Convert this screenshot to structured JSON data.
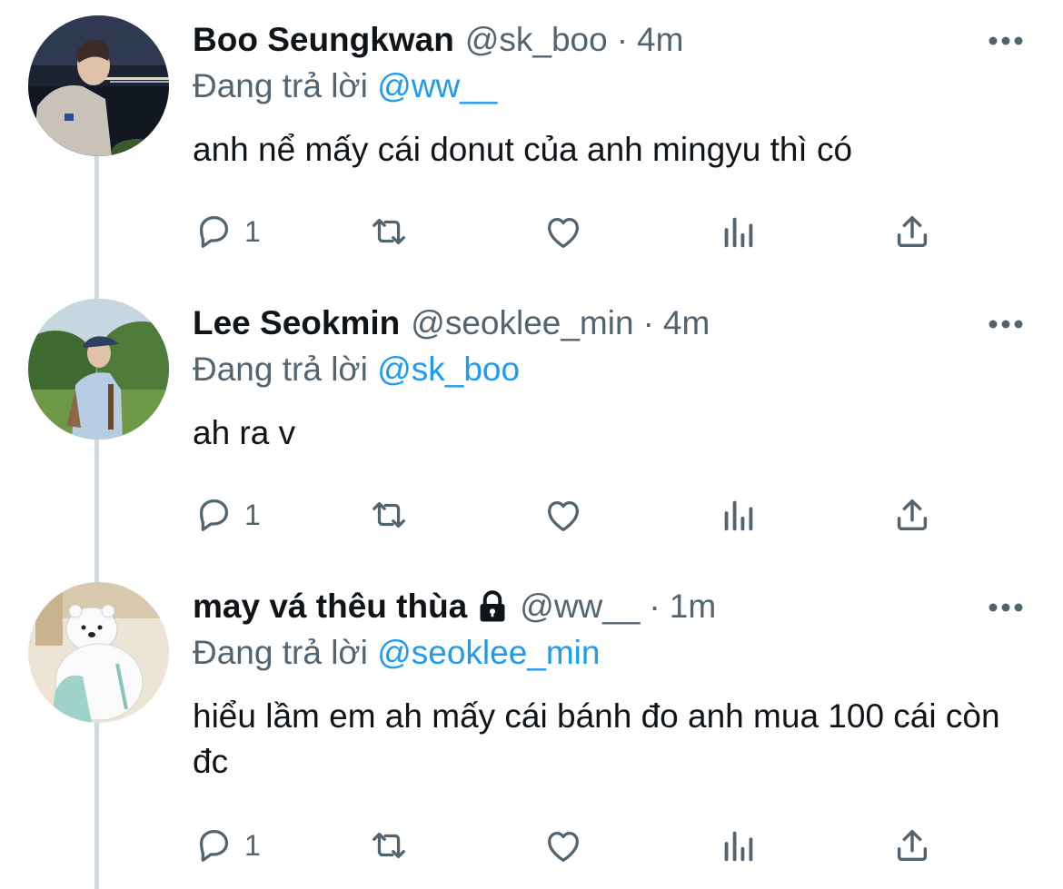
{
  "colors": {
    "text": "#0f1419",
    "secondary": "#536471",
    "link": "#1d9bf0",
    "thread_line": "#cfd9de"
  },
  "tweets": [
    {
      "name": "Boo Seungkwan",
      "handle": "@sk_boo",
      "separator": "·",
      "time": "4m",
      "locked": false,
      "reply_prefix": "Đang trả lời",
      "reply_to": "@ww__",
      "text": "anh nể mấy cái donut của anh mingyu thì có",
      "reply_count": "1",
      "icons": [
        "reply-icon",
        "retweet-icon",
        "like-icon",
        "analytics-icon",
        "share-icon",
        "more-icon"
      ]
    },
    {
      "name": "Lee Seokmin",
      "handle": "@seoklee_min",
      "separator": "·",
      "time": "4m",
      "locked": false,
      "reply_prefix": "Đang trả lời",
      "reply_to": "@sk_boo",
      "text": "ah ra v",
      "reply_count": "1",
      "icons": [
        "reply-icon",
        "retweet-icon",
        "like-icon",
        "analytics-icon",
        "share-icon",
        "more-icon"
      ]
    },
    {
      "name": "may vá thêu thùa",
      "handle": "@ww__",
      "separator": "·",
      "time": "1m",
      "locked": true,
      "reply_prefix": "Đang trả lời",
      "reply_to": "@seoklee_min",
      "text": "hiểu lầm em ah mấy cái bánh đo anh mua 100 cái còn đc",
      "reply_count": "1",
      "icons": [
        "reply-icon",
        "retweet-icon",
        "like-icon",
        "analytics-icon",
        "share-icon",
        "more-icon"
      ]
    }
  ]
}
